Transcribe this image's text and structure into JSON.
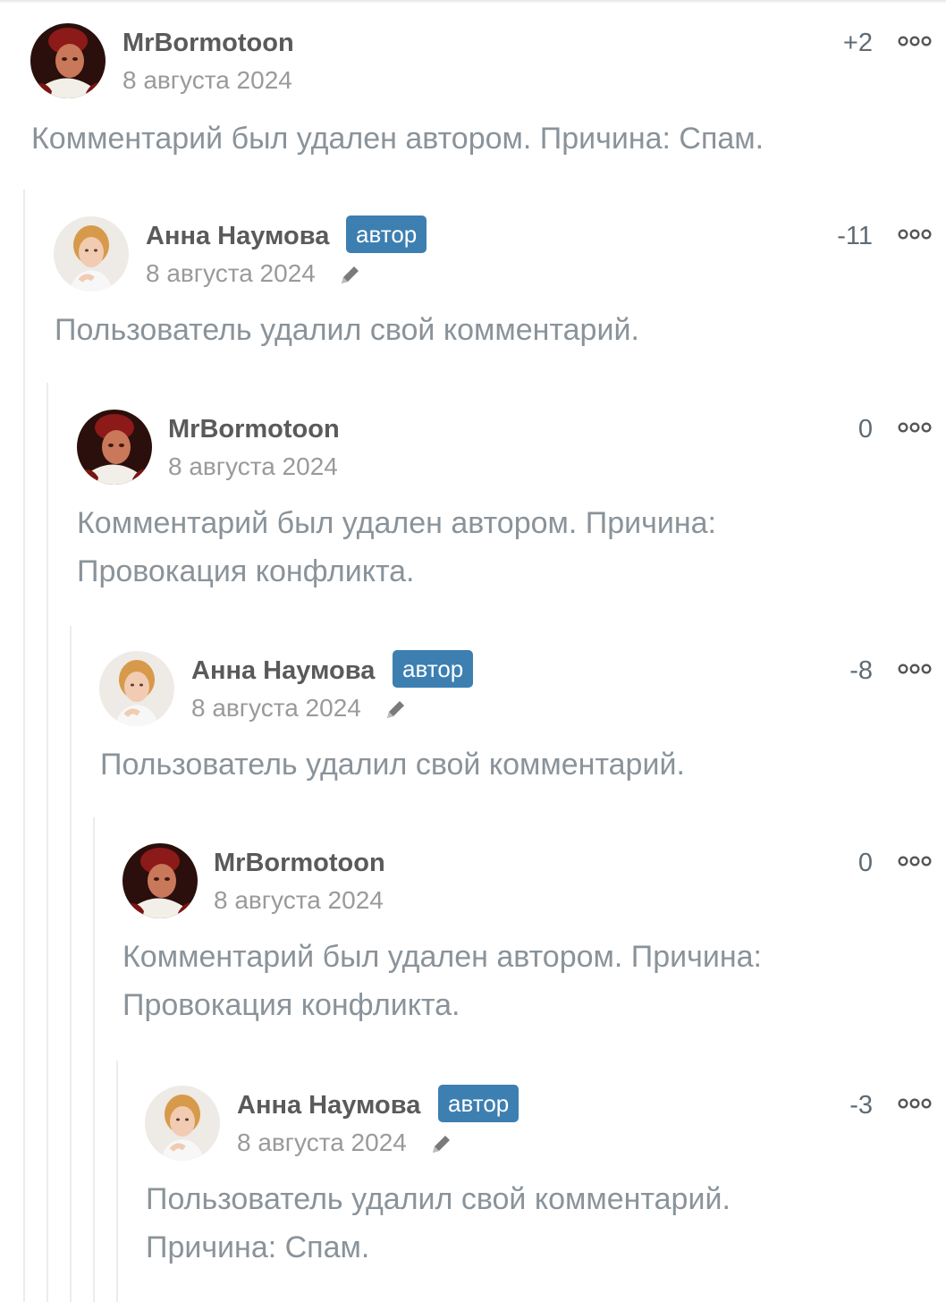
{
  "comments": [
    {
      "author": "MrBormotoon",
      "date": "8 августа 2024",
      "score": "+2",
      "text": "Комментарий был удален автором. Причина: Спам.",
      "badge": "",
      "edited": false
    },
    {
      "author": "Анна Наумова",
      "date": "8 августа 2024",
      "score": "-11",
      "text": "Пользователь удалил свой комментарий.",
      "badge": "автор",
      "edited": true
    },
    {
      "author": "MrBormotoon",
      "date": "8 августа 2024",
      "score": "0",
      "text": "Комментарий был удален автором. Причина: Провокация конфликта.",
      "badge": "",
      "edited": false
    },
    {
      "author": "Анна Наумова",
      "date": "8 августа 2024",
      "score": "-8",
      "text": "Пользователь удалил свой комментарий.",
      "badge": "автор",
      "edited": true
    },
    {
      "author": "MrBormotoon",
      "date": "8 августа 2024",
      "score": "0",
      "text": "Комментарий был удален автором. Причина: Провокация конфликта.",
      "badge": "",
      "edited": false
    },
    {
      "author": "Анна Наумова",
      "date": "8 августа 2024",
      "score": "-3",
      "text": "Пользователь удалил свой комментарий. Причина: Спам.",
      "badge": "автор",
      "edited": true
    }
  ],
  "icons": {
    "more": "more-options-icon",
    "edit": "pencil-icon"
  },
  "colors": {
    "badge": "#3d7fb1",
    "username": "#5a5a5a",
    "meta": "#9a9a9a",
    "body": "#8a939a",
    "thread_line": "#ececec"
  }
}
